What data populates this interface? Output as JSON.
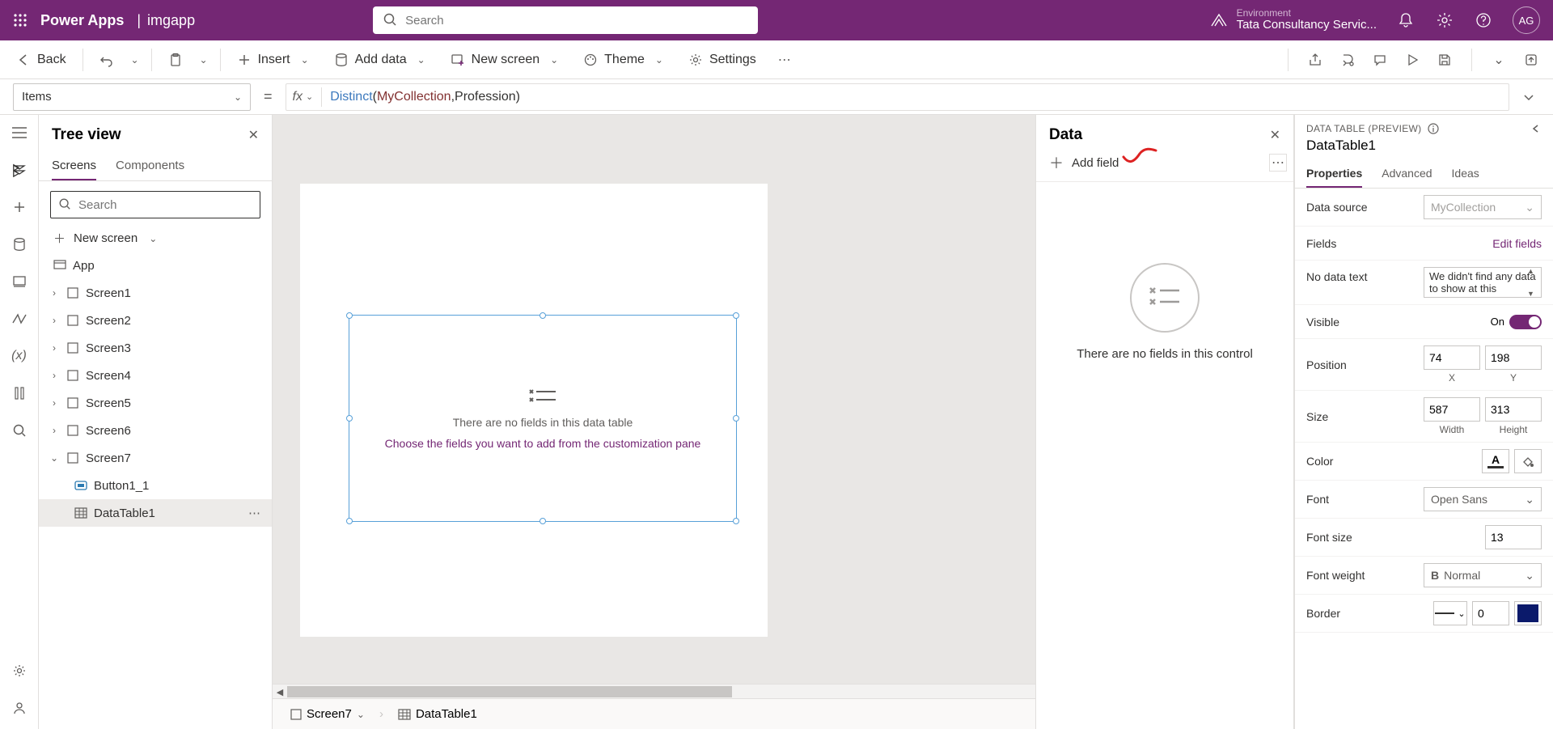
{
  "header": {
    "product": "Power Apps",
    "separator": "|",
    "app": "imgapp",
    "search_placeholder": "Search",
    "env_label": "Environment",
    "env_name": "Tata Consultancy Servic...",
    "avatar_initials": "AG"
  },
  "command_bar": {
    "back": "Back",
    "insert": "Insert",
    "add_data": "Add data",
    "new_screen": "New screen",
    "theme": "Theme",
    "settings": "Settings"
  },
  "formula": {
    "property": "Items",
    "fx": "fx",
    "expression_parts": {
      "func": "Distinct",
      "lp": "( ",
      "ident1": "MyCollection",
      "comma": ", ",
      "ident2": "Profession",
      "rp": " )"
    }
  },
  "tree": {
    "title": "Tree view",
    "tabs": {
      "screens": "Screens",
      "components": "Components"
    },
    "search_placeholder": "Search",
    "new_screen": "New screen",
    "items": {
      "app": "App",
      "s1": "Screen1",
      "s2": "Screen2",
      "s3": "Screen3",
      "s4": "Screen4",
      "s5": "Screen5",
      "s6": "Screen6",
      "s7": "Screen7",
      "btn": "Button1_1",
      "dt": "DataTable1"
    }
  },
  "canvas": {
    "empty_title": "There are no fields in this data table",
    "empty_hint": "Choose the fields you want to add from the customization pane"
  },
  "breadcrumb": {
    "screen": "Screen7",
    "control": "DataTable1"
  },
  "data_panel": {
    "title": "Data",
    "add_field": "Add field",
    "empty_text": "There are no fields in this control"
  },
  "props": {
    "header": "DATA TABLE (PREVIEW)",
    "name": "DataTable1",
    "tabs": {
      "properties": "Properties",
      "advanced": "Advanced",
      "ideas": "Ideas"
    },
    "data_source_label": "Data source",
    "data_source_value": "MyCollection",
    "fields_label": "Fields",
    "edit_fields": "Edit fields",
    "no_data_label": "No data text",
    "no_data_value": "We didn't find any data to show at this ",
    "visible_label": "Visible",
    "visible_state": "On",
    "position_label": "Position",
    "pos_x": "74",
    "pos_y": "198",
    "pos_xl": "X",
    "pos_yl": "Y",
    "size_label": "Size",
    "size_w": "587",
    "size_h": "313",
    "size_wl": "Width",
    "size_hl": "Height",
    "color_label": "Color",
    "font_label": "Font",
    "font_value": "Open Sans",
    "font_size_label": "Font size",
    "font_size_value": "13",
    "font_weight_label": "Font weight",
    "font_weight_value": "Normal",
    "border_label": "Border",
    "border_value": "0",
    "colors": {
      "text": "#323130",
      "border_fill": "#0b1a6b"
    }
  }
}
